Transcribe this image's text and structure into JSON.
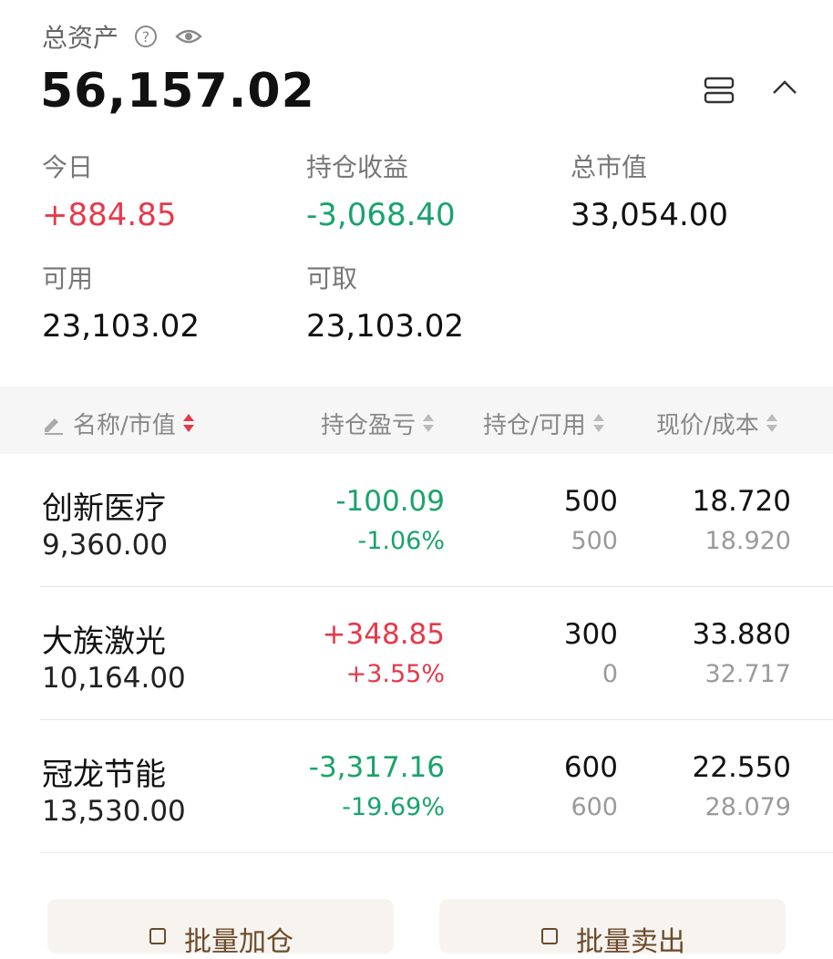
{
  "summary": {
    "total_label": "总资产",
    "help_glyph": "?",
    "total_value": "56,157.02",
    "stats": {
      "today": {
        "label": "今日",
        "value": "+884.85",
        "tone": "up"
      },
      "holding_pnl": {
        "label": "持仓收益",
        "value": "-3,068.40",
        "tone": "down"
      },
      "market_value": {
        "label": "总市值",
        "value": "33,054.00"
      },
      "available": {
        "label": "可用",
        "value": "23,103.02"
      },
      "withdrawable": {
        "label": "可取",
        "value": "23,103.02"
      }
    },
    "icons": [
      "help-icon",
      "eye-icon",
      "layout-icon",
      "chevron-up-icon"
    ]
  },
  "table": {
    "columns": {
      "name": "名称/市值",
      "pnl": "持仓盈亏",
      "position": "持仓/可用",
      "price": "现价/成本"
    },
    "rows": [
      {
        "name": "创新医疗",
        "market_value": "9,360.00",
        "pnl": "-100.09",
        "pnl_pct": "-1.06%",
        "tone": "down",
        "position": "500",
        "available": "500",
        "price": "18.720",
        "cost": "18.920"
      },
      {
        "name": "大族激光",
        "market_value": "10,164.00",
        "pnl": "+348.85",
        "pnl_pct": "+3.55%",
        "tone": "up",
        "position": "300",
        "available": "0",
        "price": "33.880",
        "cost": "32.717"
      },
      {
        "name": "冠龙节能",
        "market_value": "13,530.00",
        "pnl": "-3,317.16",
        "pnl_pct": "-19.69%",
        "tone": "down",
        "position": "600",
        "available": "600",
        "price": "22.550",
        "cost": "28.079"
      }
    ]
  },
  "actions": {
    "batch_buy": "批量加仓",
    "batch_sell": "批量卖出"
  },
  "colors": {
    "up": "#e6394a",
    "down": "#1aa36b",
    "accent": "#6b4a2a"
  }
}
